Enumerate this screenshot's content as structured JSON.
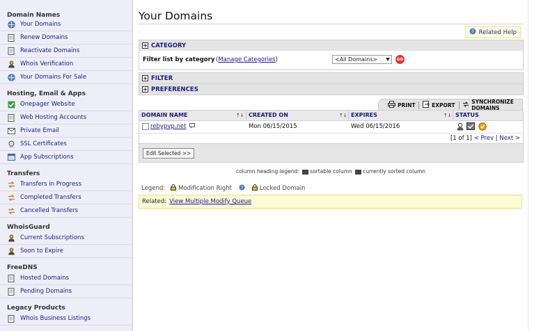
{
  "sidebar": {
    "sections": [
      {
        "title": "Domain Names",
        "items": [
          {
            "label": "Your Domains",
            "icon": "globe-icon"
          },
          {
            "label": "Renew Domains",
            "icon": "document-icon"
          },
          {
            "label": "Reactivate Domains",
            "icon": "document-icon"
          },
          {
            "label": "Whois Verification",
            "icon": "user-icon"
          },
          {
            "label": "Your Domains For Sale",
            "icon": "globe-icon"
          }
        ]
      },
      {
        "title": "Hosting, Email & Apps",
        "items": [
          {
            "label": "Onepager Website",
            "icon": "check-icon"
          },
          {
            "label": "Web Hosting Accounts",
            "icon": "document-icon"
          },
          {
            "label": "Private Email",
            "icon": "email-icon"
          },
          {
            "label": "SSL Certificates",
            "icon": "certificate-icon"
          },
          {
            "label": "App Subscriptions",
            "icon": "app-icon"
          }
        ]
      },
      {
        "title": "Transfers",
        "items": [
          {
            "label": "Transfers in Progress",
            "icon": "transfer-icon"
          },
          {
            "label": "Completed Transfers",
            "icon": "transfer-icon"
          },
          {
            "label": "Cancelled Transfers",
            "icon": "transfer-icon"
          }
        ]
      },
      {
        "title": "WhoisGuard",
        "items": [
          {
            "label": "Current Subscriptions",
            "icon": "user-icon"
          },
          {
            "label": "Soon to Expire",
            "icon": "user-icon"
          }
        ]
      },
      {
        "title": "FreeDNS",
        "items": [
          {
            "label": "Hosted Domains",
            "icon": "document-icon"
          },
          {
            "label": "Pending Domains",
            "icon": "document-icon"
          }
        ]
      },
      {
        "title": "Legacy Products",
        "items": [
          {
            "label": "Whois Business Listings",
            "icon": "document-icon"
          }
        ]
      }
    ]
  },
  "main": {
    "title": "Your Domains",
    "help_label": "Related Help",
    "category_label": "CATEGORY",
    "filter_list_label": "Filter list by category",
    "manage_open": "(",
    "manage_link": "Manage Categories",
    "manage_close": ")",
    "category_select_value": "<All Domains>",
    "go_label": "GO",
    "filter_label": "FILTER",
    "preferences_label": "PREFERENCES",
    "toolbar": {
      "print": "PRINT",
      "export": "EXPORT",
      "sync": "SYNCHRONIZE DOMAINS"
    },
    "grid": {
      "columns": {
        "domain": "DOMAIN NAME",
        "created": "CREATED ON",
        "expires": "EXPIRES",
        "status": "STATUS"
      },
      "sort_glyph": "↑↓",
      "rows": [
        {
          "domain": "rebypvp.net",
          "created": "Mon 06/15/2015",
          "expires": "Wed 06/15/2016"
        }
      ],
      "pager": {
        "count": "[1 of 1]",
        "prev": "< Prev",
        "sep": "|",
        "next": "Next >"
      }
    },
    "edit_selected": "Edit Selected >>",
    "column_legend": {
      "prefix": "column heading legend:",
      "sortable": "sortable column",
      "sorted": "currently sorted column"
    },
    "legend": {
      "label": "Legend:",
      "modification": "Modification Right",
      "locked": "Locked Domain"
    },
    "related": {
      "label": "Related:",
      "link": "View Multiple Modify Queue"
    }
  },
  "colors": {
    "link": "#1a1a80",
    "sidebar_bg": "#eeeef9",
    "go_button": "#e03a3a",
    "related_bg": "#fcfcd8"
  }
}
